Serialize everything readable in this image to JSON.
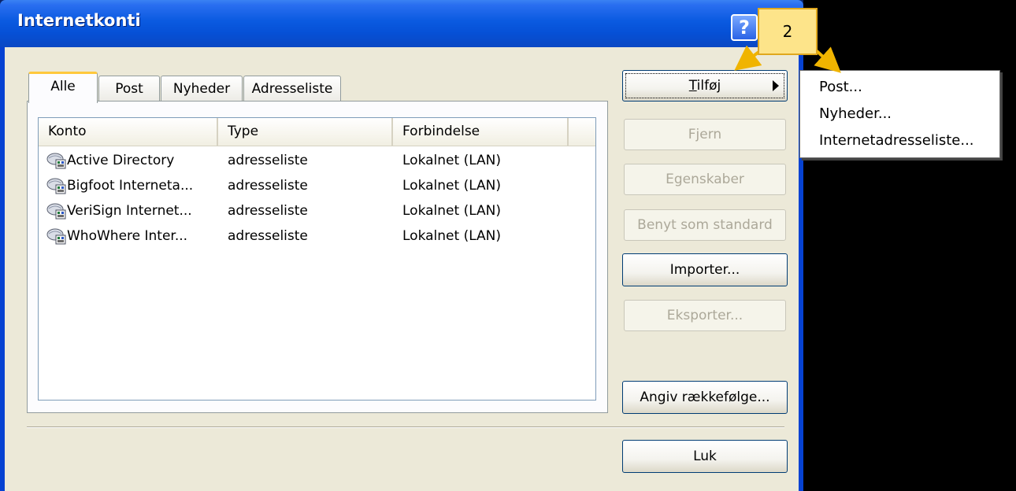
{
  "window": {
    "title": "Internetkonti",
    "help_label": "?"
  },
  "tabs": [
    {
      "label": "Alle",
      "active": true
    },
    {
      "label": "Post",
      "active": false
    },
    {
      "label": "Nyheder",
      "active": false
    },
    {
      "label": "Adresseliste",
      "active": false
    }
  ],
  "list": {
    "columns": [
      "Konto",
      "Type",
      "Forbindelse"
    ],
    "rows": [
      {
        "account": "Active Directory",
        "type": "adresseliste",
        "connection": "Lokalnet (LAN)"
      },
      {
        "account": "Bigfoot Interneta...",
        "type": "adresseliste",
        "connection": "Lokalnet (LAN)"
      },
      {
        "account": "VeriSign Internet...",
        "type": "adresseliste",
        "connection": "Lokalnet (LAN)"
      },
      {
        "account": "WhoWhere Inter...",
        "type": "adresseliste",
        "connection": "Lokalnet (LAN)"
      }
    ]
  },
  "buttons": {
    "add_first": "T",
    "add_rest": "ilføj",
    "remove": "Fjern",
    "properties": "Egenskaber",
    "set_default": "Benyt som standard",
    "import": "Importer...",
    "export": "Eksporter...",
    "set_order": "Angiv rækkefølge...",
    "close": "Luk"
  },
  "menu": {
    "items": [
      "Post...",
      "Nyheder...",
      "Internetadresseliste..."
    ]
  },
  "callout": {
    "label": "2",
    "color": "#fde48a",
    "arrow_color": "#f0b400"
  },
  "colors": {
    "title_bar": "#0a5ae0",
    "dialog_face": "#ece9d8",
    "button_border": "#003c74",
    "tab_highlight": "#ffc83c"
  }
}
